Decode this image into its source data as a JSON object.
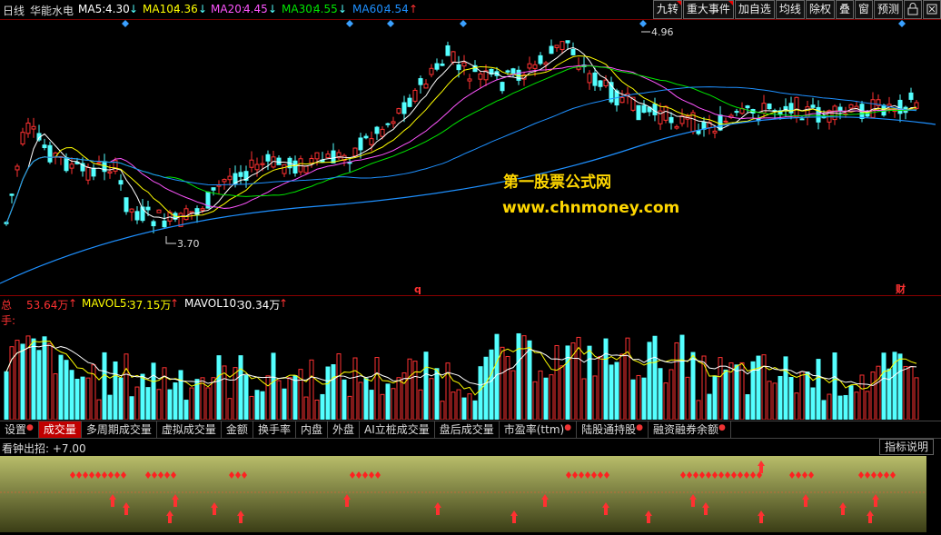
{
  "topbar": {
    "period": "日线",
    "stock_name": "华能水电",
    "ma5_label": "MA5:",
    "ma5_value": "4.30",
    "ma10_label": "MA10:",
    "ma10_value": "4.36",
    "ma20_label": "MA20:",
    "ma20_value": "4.45",
    "ma30_label": "MA30:",
    "ma30_value": "4.55",
    "ma60_label": "MA60:",
    "ma60_value": "4.54",
    "arrow_down": "↓",
    "arrow_up": "↑"
  },
  "toolbar": [
    "九转",
    "重大事件",
    "加自选",
    "均线",
    "除权",
    "叠",
    "窗",
    "预测"
  ],
  "main": {
    "high_label": "4.96",
    "low_label": "3.70",
    "marker_q": "q",
    "marker_cai": "财",
    "watermark_cn": "第一股票公式网",
    "watermark_url": "www.chnmoney.com"
  },
  "volume": {
    "total_label": "总手:",
    "total_value": "53.64万",
    "mavol5_label": "MAVOL5:",
    "mavol5_value": "37.15万",
    "mavol10_label": "MAVOL10:",
    "mavol10_value": "30.34万",
    "arrow_up": "↑"
  },
  "tabs": [
    {
      "label": "设置",
      "dot": true
    },
    {
      "label": "成交量",
      "dot": false,
      "active": true
    },
    {
      "label": "多周期成交量",
      "dot": false
    },
    {
      "label": "虚拟成交量",
      "dot": false
    },
    {
      "label": "金额",
      "dot": false
    },
    {
      "label": "换手率",
      "dot": false
    },
    {
      "label": "内盘",
      "dot": false
    },
    {
      "label": "外盘",
      "dot": false
    },
    {
      "label": "AI立桩成交量",
      "dot": false
    },
    {
      "label": "盘后成交量",
      "dot": false
    },
    {
      "label": "市盈率(ttm)",
      "dot": true
    },
    {
      "label": "陆股通持股",
      "dot": true
    },
    {
      "label": "融资融券余额",
      "dot": true
    }
  ],
  "indicator": {
    "name": "看钟出招:",
    "value": "+7.00",
    "button": "指标说明"
  },
  "colors": {
    "up": "#ff3232",
    "down": "#54ffff",
    "ma5": "#ffffff",
    "ma10": "#ffff00",
    "ma20": "#ff55ff",
    "ma30": "#00e600",
    "ma60": "#1e90ff",
    "accent": "#c00000"
  },
  "icons": [
    "lock-icon",
    "expand-icon",
    "diamond-marker-icon",
    "red-diamond-icon",
    "red-up-arrow-icon"
  ]
}
